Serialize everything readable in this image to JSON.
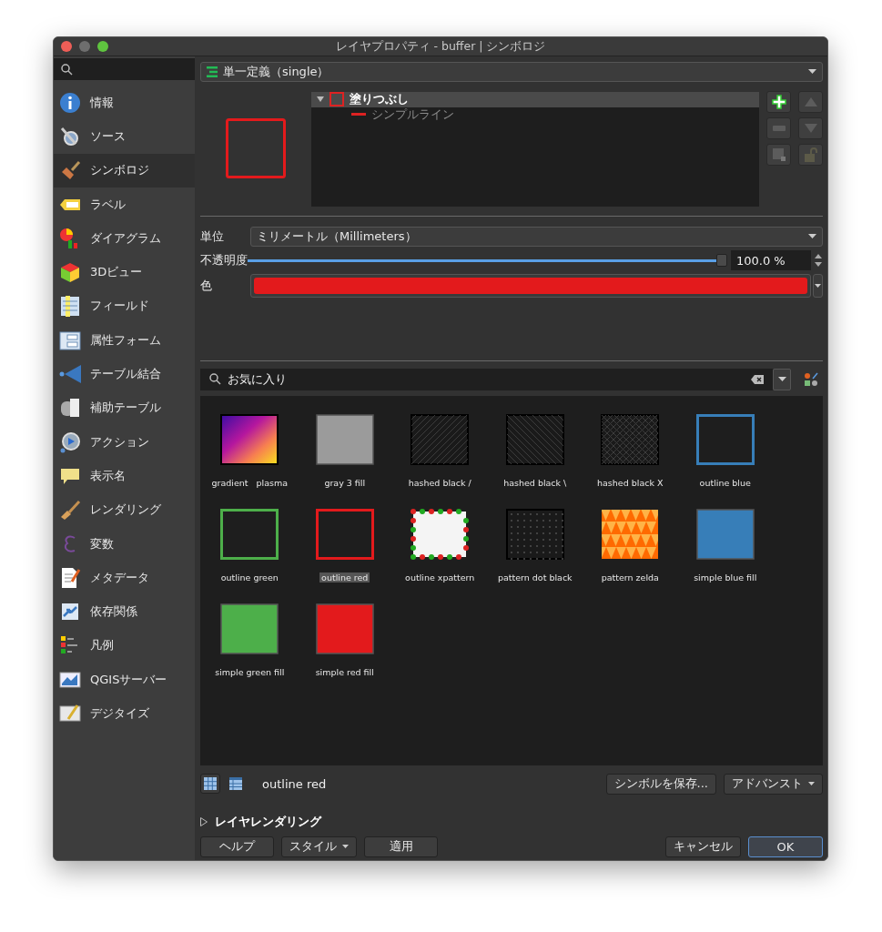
{
  "window": {
    "title": "レイヤプロパティ - buffer | シンボロジ"
  },
  "sidebar": {
    "items": [
      {
        "label": "情報",
        "selected": false
      },
      {
        "label": "ソース",
        "selected": false
      },
      {
        "label": "シンボロジ",
        "selected": true
      },
      {
        "label": "ラベル",
        "selected": false
      },
      {
        "label": "ダイアグラム",
        "selected": false
      },
      {
        "label": "3Dビュー",
        "selected": false
      },
      {
        "label": "フィールド",
        "selected": false
      },
      {
        "label": "属性フォーム",
        "selected": false
      },
      {
        "label": "テーブル結合",
        "selected": false
      },
      {
        "label": "補助テーブル",
        "selected": false
      },
      {
        "label": "アクション",
        "selected": false
      },
      {
        "label": "表示名",
        "selected": false
      },
      {
        "label": "レンダリング",
        "selected": false
      },
      {
        "label": "変数",
        "selected": false
      },
      {
        "label": "メタデータ",
        "selected": false
      },
      {
        "label": "依存関係",
        "selected": false
      },
      {
        "label": "凡例",
        "selected": false
      },
      {
        "label": "QGISサーバー",
        "selected": false
      },
      {
        "label": "デジタイズ",
        "selected": false
      }
    ]
  },
  "renderer_dropdown": {
    "value": "単一定義（single）"
  },
  "symbol_tree": {
    "rows": [
      {
        "label": "塗りつぶし",
        "selected": true,
        "expanded": true,
        "children": [
          {
            "label": "シンプルライン",
            "selected": false
          }
        ]
      }
    ]
  },
  "layer_buttons": [
    {
      "kind": "add",
      "disabled": false
    },
    {
      "kind": "up",
      "disabled": true
    },
    {
      "kind": "remove",
      "disabled": true
    },
    {
      "kind": "down",
      "disabled": true
    },
    {
      "kind": "duplicate",
      "disabled": true
    },
    {
      "kind": "lock",
      "disabled": true
    }
  ],
  "unit": {
    "label": "単位",
    "value": "ミリメートル（Millimeters）"
  },
  "opacity": {
    "label": "不透明度",
    "level": 1.0,
    "reading": "100.0 %"
  },
  "color_field": {
    "label": "色",
    "color": "#e31a1c"
  },
  "library_search": {
    "value": "お気に入り"
  },
  "symbols": [
    {
      "label": "gradient   plasma",
      "kind": "gradient",
      "selected": false
    },
    {
      "label": "gray 3 fill",
      "kind": "fill",
      "color": "#9b9b9b",
      "selected": false
    },
    {
      "label": "hashed black /",
      "kind": "hatch-forward",
      "selected": false
    },
    {
      "label": "hashed black \\",
      "kind": "hatch-back",
      "selected": false
    },
    {
      "label": "hashed black X",
      "kind": "hatch-cross",
      "selected": false
    },
    {
      "label": "outline blue",
      "kind": "outline",
      "color": "#377eb8",
      "selected": false
    },
    {
      "label": "outline green",
      "kind": "outline",
      "color": "#4daf4a",
      "selected": false
    },
    {
      "label": "outline red",
      "kind": "outline",
      "color": "#e31a1c",
      "selected": true
    },
    {
      "label": "outline xpattern",
      "kind": "dot-border",
      "selected": false
    },
    {
      "label": "pattern dot black",
      "kind": "dots",
      "selected": false
    },
    {
      "label": "pattern zelda",
      "kind": "zelda",
      "selected": false
    },
    {
      "label": "simple blue fill",
      "kind": "fill",
      "color": "#377eb8",
      "selected": false
    },
    {
      "label": "simple green fill",
      "kind": "fill",
      "color": "#4daf4a",
      "selected": false
    },
    {
      "label": "simple red fill",
      "kind": "fill",
      "color": "#e31a1c",
      "selected": false
    }
  ],
  "view_toggles": [
    {
      "kind": "icons",
      "selected": true
    },
    {
      "kind": "list",
      "selected": false
    }
  ],
  "selected_symbol_name": "outline red",
  "save_button": "シンボルを保存...",
  "advanced_button": "アドバンスト",
  "layer_rendering": {
    "label": "レイヤレンダリング",
    "expanded": false
  },
  "footer_buttons": [
    {
      "label": "ヘルプ",
      "kind": "plain"
    },
    {
      "label": "スタイル",
      "kind": "menu"
    },
    {
      "label": "適用",
      "kind": "plain"
    }
  ],
  "dialog_buttons": [
    {
      "label": "キャンセル",
      "default": false
    },
    {
      "label": "OK",
      "default": true
    }
  ]
}
